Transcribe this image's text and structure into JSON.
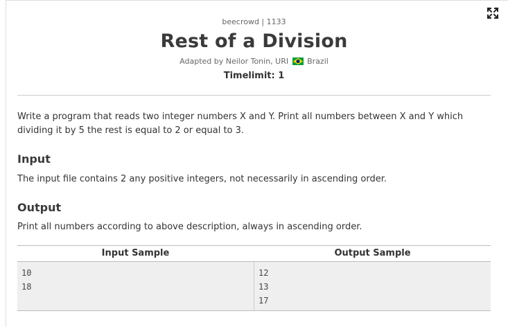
{
  "problem": {
    "source": "beecrowd | 1133",
    "title": "Rest of a Division",
    "adapted_prefix": "Adapted by Neilor Tonin, URI",
    "country": "Brazil",
    "timelimit": "Timelimit: 1",
    "statement": "Write a program that reads two integer numbers X and Y. Print all numbers between X and Y which dividing it by 5 the rest is equal to 2 or equal to 3.",
    "input_heading": "Input",
    "input_text": "The input file contains 2 any positive integers, not necessarily in ascending order.",
    "output_heading": "Output",
    "output_text": "Print all numbers according to above description, always in ascending order."
  },
  "samples": {
    "input_header": "Input Sample",
    "output_header": "Output Sample",
    "input_lines": [
      "10",
      "18"
    ],
    "output_lines": [
      "12",
      "13",
      "17"
    ]
  },
  "icons": {
    "expand": "expand-icon",
    "flag": "brazil-flag-icon"
  },
  "colors": {
    "title": "#3a3a3a",
    "text": "#333333",
    "muted": "#666666",
    "sample_bg": "#efefef",
    "flag_green": "#009c3b",
    "flag_yellow": "#ffdf00",
    "flag_blue": "#002776"
  }
}
